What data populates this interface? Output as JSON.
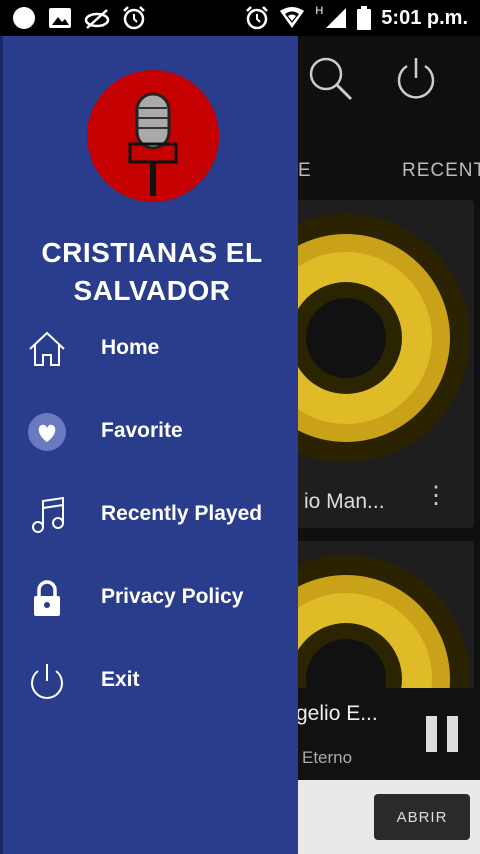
{
  "status_bar": {
    "time": "5:01 p.m.",
    "network_type": "H",
    "icons": [
      "circle-icon",
      "image-icon",
      "blocked-notification-icon",
      "alarm-icon",
      "alarm-icon",
      "wifi-icon",
      "signal-icon",
      "battery-icon"
    ]
  },
  "drawer": {
    "title": "CRISTIANAS EL SALVADOR",
    "logo_icon": "microphone-logo",
    "items": [
      {
        "label": "Home",
        "icon": "home-icon"
      },
      {
        "label": "Favorite",
        "icon": "heart-icon"
      },
      {
        "label": "Recently Played",
        "icon": "music-note-icon"
      },
      {
        "label": "Privacy Policy",
        "icon": "lock-icon"
      },
      {
        "label": "Exit",
        "icon": "power-icon"
      }
    ]
  },
  "background": {
    "tabs": [
      "E",
      "RECENT"
    ],
    "cards": [
      {
        "title": "io Man..."
      }
    ],
    "player": {
      "title": "gelio E...",
      "subtitle": "Eterno"
    },
    "ad": {
      "button_label": "ABRIR"
    }
  },
  "colors": {
    "drawer_bg": "#2a3d8c",
    "logo_bg": "#c40000",
    "app_bg": "#0f0f0f"
  }
}
